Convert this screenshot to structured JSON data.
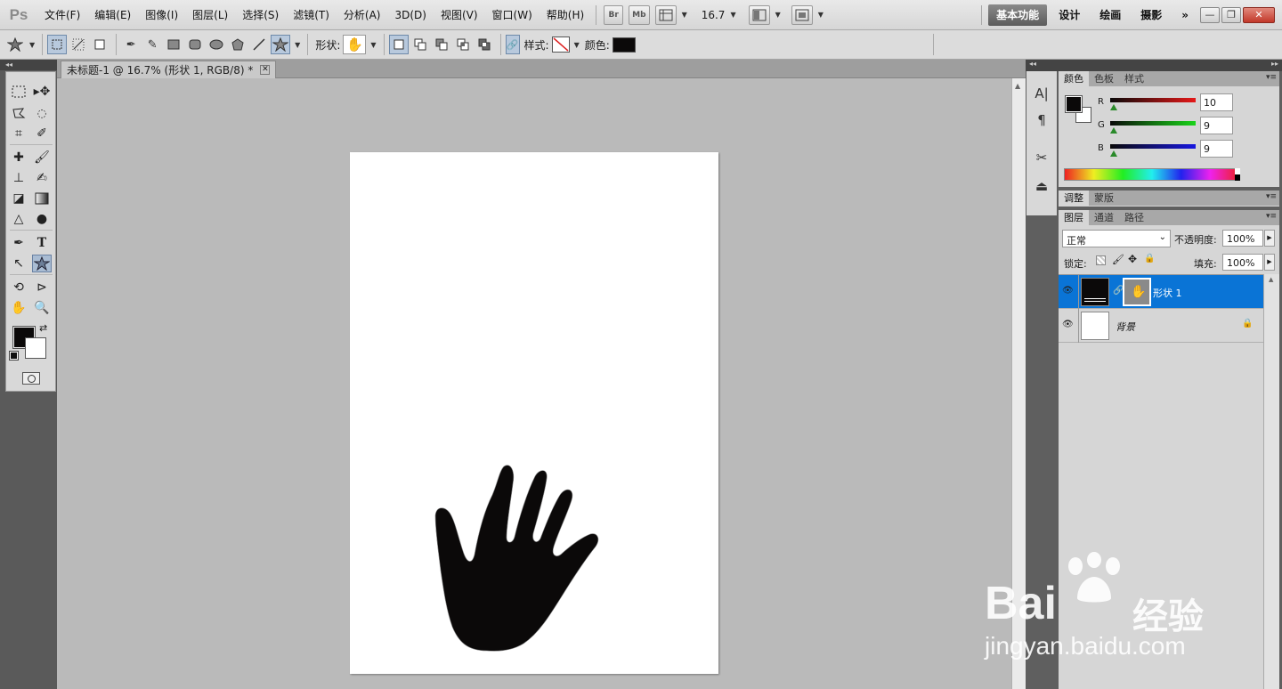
{
  "app": {
    "logo": "Ps"
  },
  "menu": [
    "文件(F)",
    "编辑(E)",
    "图像(I)",
    "图层(L)",
    "选择(S)",
    "滤镜(T)",
    "分析(A)",
    "3D(D)",
    "视图(V)",
    "窗口(W)",
    "帮助(H)"
  ],
  "menubar": {
    "bridge": "Br",
    "minibridge": "Mb",
    "zoom": "16.7",
    "workspaces": [
      "基本功能",
      "设计",
      "绘画",
      "摄影"
    ],
    "more": "»"
  },
  "options": {
    "shape_label": "形状:",
    "style_label": "样式:",
    "color_label": "颜色:",
    "color": "#0b0909"
  },
  "document": {
    "tab_title": "未标题-1 @ 16.7% (形状 1, RGB/8) *"
  },
  "color_panel": {
    "tabs": [
      "颜色",
      "色板",
      "样式"
    ],
    "channels": [
      {
        "label": "R",
        "value": "10"
      },
      {
        "label": "G",
        "value": "9"
      },
      {
        "label": "B",
        "value": "9"
      }
    ]
  },
  "adjust_panel": {
    "tabs": [
      "调整",
      "蒙版"
    ]
  },
  "layers_panel": {
    "tabs": [
      "图层",
      "通道",
      "路径"
    ],
    "blend_mode": "正常",
    "opacity_label": "不透明度:",
    "opacity": "100%",
    "lock_label": "锁定:",
    "fill_label": "填充:",
    "fill": "100%",
    "layers": [
      {
        "name": "形状 1",
        "selected": true
      },
      {
        "name": "背景",
        "selected": false,
        "locked": true
      }
    ]
  },
  "watermark": {
    "brand": "Bai",
    "brand_suffix": "经验",
    "url": "jingyan.baidu.com"
  },
  "colors": {
    "selection": "#0a74d6",
    "foreground": "#0b0909",
    "background": "#ffffff"
  }
}
